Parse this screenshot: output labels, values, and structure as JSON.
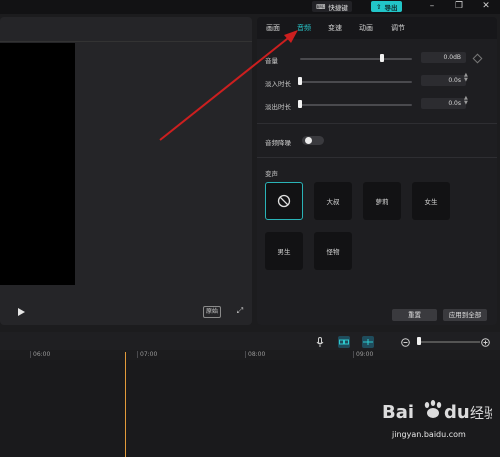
{
  "topbar": {
    "shortcut_label": "快捷键",
    "export_label": "导出"
  },
  "inspector": {
    "tabs": [
      {
        "label": "画面"
      },
      {
        "label": "音频",
        "active": true
      },
      {
        "label": "变速"
      },
      {
        "label": "动画"
      },
      {
        "label": "调节"
      }
    ],
    "volume": {
      "label": "音量",
      "value": "0.0dB",
      "level": 0.67
    },
    "fade_in": {
      "label": "淡入时长",
      "value": "0.0s",
      "level": 0.0
    },
    "fade_out": {
      "label": "淡出时长",
      "value": "0.0s",
      "level": 0.0
    },
    "noise_reduction": {
      "label": "音频降噪",
      "on": false
    },
    "voice_section_title": "变声",
    "voices": [
      "大叔",
      "萝莉",
      "女生",
      "男生",
      "怪物"
    ],
    "reset_label": "重置",
    "apply_all_label": "应用到全部"
  },
  "preview": {
    "ratio_label": "原始"
  },
  "timeline": {
    "ticks": [
      "06:00",
      "07:00",
      "08:00",
      "09:00"
    ]
  },
  "watermark": {
    "brand": "Baidu经验",
    "url": "jingyan.baidu.com"
  },
  "colors": {
    "accent": "#28c8cc",
    "annotation": "#cc1f1f",
    "playhead": "#e29a3a"
  }
}
